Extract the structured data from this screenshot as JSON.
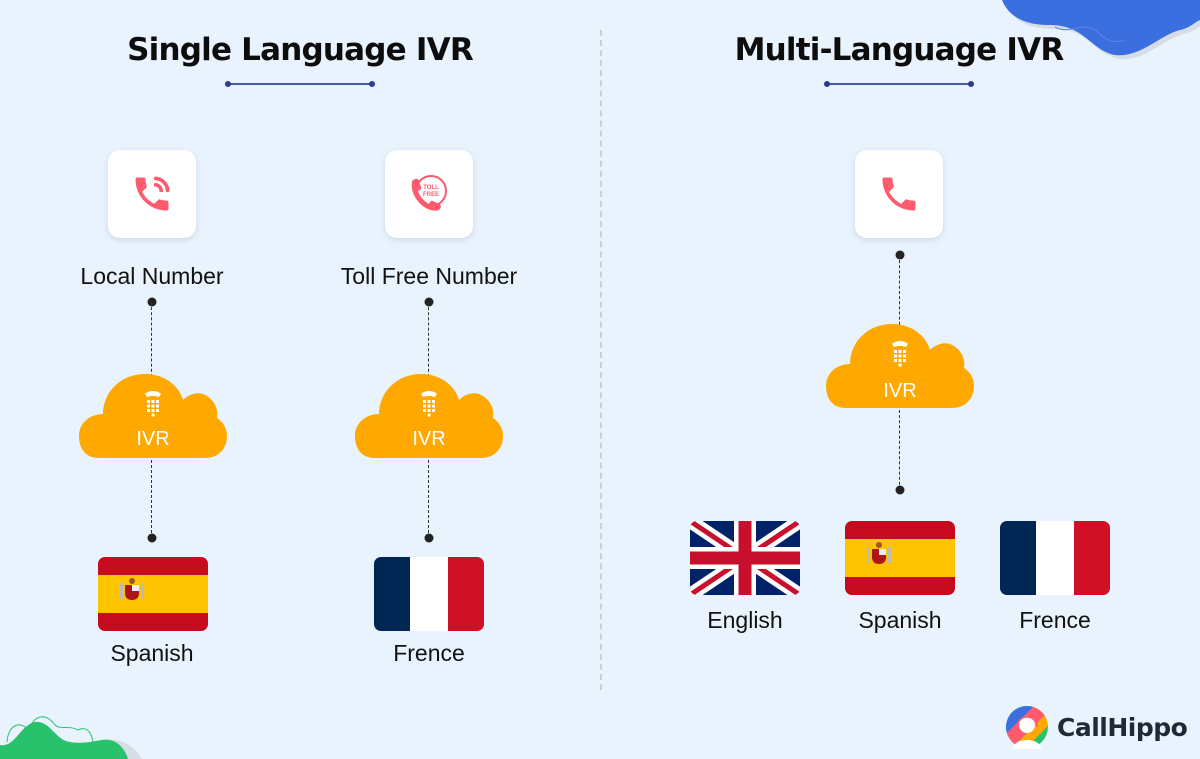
{
  "colors": {
    "background": "#e9f3fd",
    "icon_red": "#ff5a6e",
    "cloud_orange": "#ffa800",
    "title_rule": "#2e3a8c",
    "blob_blue": "#3b6fe0",
    "blob_green": "#27c26b"
  },
  "single": {
    "title": "Single Language IVR",
    "columns": [
      {
        "source_label": "Local Number",
        "source_icon": "phone-ringing-icon",
        "cloud_label": "IVR",
        "language": "Spanish",
        "flag": "spain"
      },
      {
        "source_label": "Toll Free Number",
        "source_icon": "toll-free-phone-icon",
        "toll_free_text_1": "TOLL",
        "toll_free_text_2": "FREE",
        "cloud_label": "IVR",
        "language": "Frence",
        "flag": "france"
      }
    ]
  },
  "multi": {
    "title": "Multi-Language IVR",
    "source_icon": "phone-icon",
    "cloud_label": "IVR",
    "languages": [
      {
        "label": "English",
        "flag": "uk"
      },
      {
        "label": "Spanish",
        "flag": "spain"
      },
      {
        "label": "Frence",
        "flag": "france"
      }
    ]
  },
  "brand": {
    "name": "CallHippo"
  }
}
